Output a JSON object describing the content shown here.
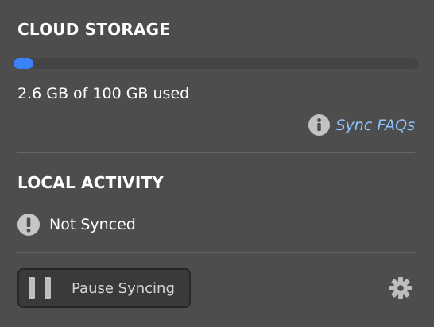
{
  "cloud_storage": {
    "title": "CLOUD STORAGE",
    "usage_text": "2.6 GB of 100 GB used",
    "used_fraction": 0.05,
    "bar_fill_color": "#3b82f6",
    "faq_link": {
      "icon": "info-icon",
      "label": "Sync FAQs",
      "color": "#8ec5ff"
    }
  },
  "local_activity": {
    "title": "LOCAL ACTIVITY",
    "status": {
      "icon": "alert-icon",
      "text": "Not Synced"
    }
  },
  "footer": {
    "pause_button": {
      "icon": "pause-icon",
      "label": "Pause Syncing"
    },
    "settings_icon": "gear-icon"
  }
}
